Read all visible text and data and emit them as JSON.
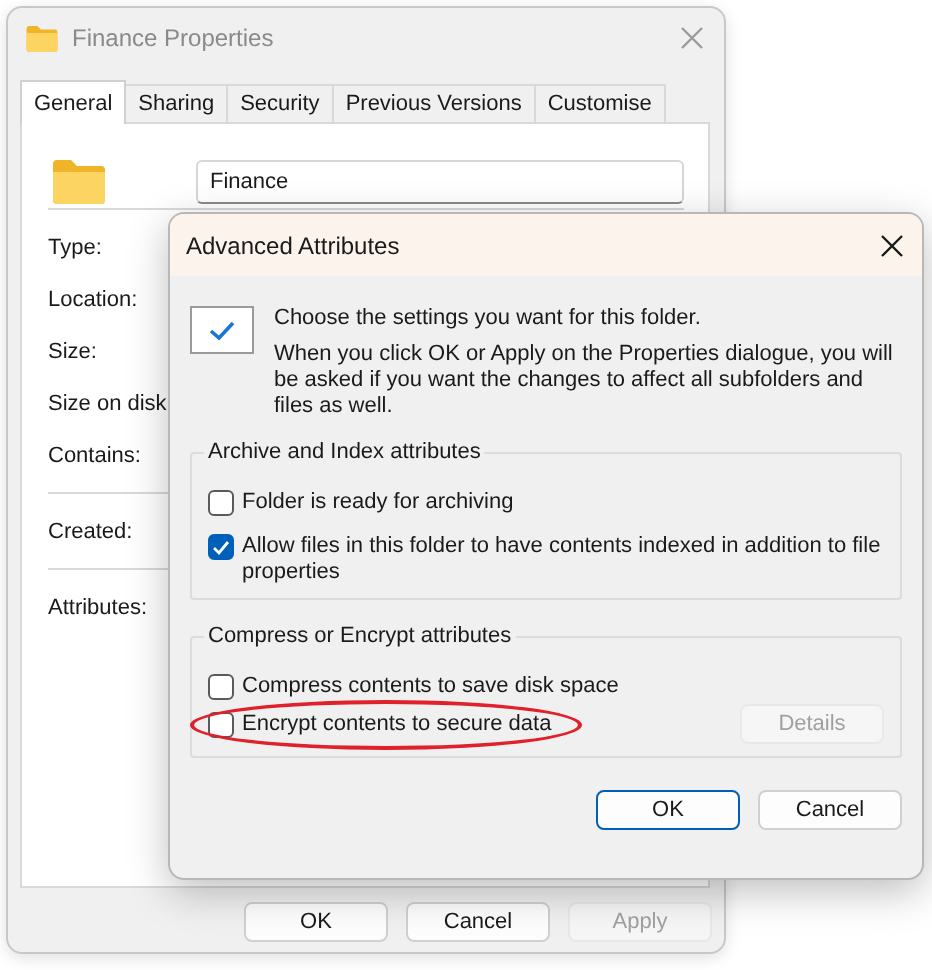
{
  "properties_window": {
    "title": "Finance Properties",
    "active": false,
    "tabs": [
      {
        "label": "General",
        "selected": true
      },
      {
        "label": "Sharing",
        "selected": false
      },
      {
        "label": "Security",
        "selected": false
      },
      {
        "label": "Previous Versions",
        "selected": false
      },
      {
        "label": "Customise",
        "selected": false
      }
    ],
    "name_field": {
      "value": "Finance"
    },
    "sections": [
      [
        "Type:",
        "Location:",
        "Size:",
        "Size on disk:",
        "Contains:"
      ],
      [
        "Created:"
      ],
      [
        "Attributes:"
      ]
    ],
    "buttons": [
      {
        "label": "OK",
        "disabled": false
      },
      {
        "label": "Cancel",
        "disabled": false
      },
      {
        "label": "Apply",
        "disabled": true
      }
    ]
  },
  "advanced_dialog": {
    "title": "Advanced Attributes",
    "heading": "Choose the settings you want for this folder.",
    "description": "When you click OK or Apply on the Properties dialogue, you will be asked if you want the changes to affect all subfolders and files as well.",
    "groups": [
      {
        "title": "Archive and Index attributes",
        "options": [
          {
            "label": "Folder is ready for archiving",
            "checked": false,
            "highlighted": false
          },
          {
            "label": "Allow files in this folder to have contents indexed in addition to file properties",
            "checked": true,
            "highlighted": false
          }
        ]
      },
      {
        "title": "Compress or Encrypt attributes",
        "options": [
          {
            "label": "Compress contents to save disk space",
            "checked": false,
            "highlighted": false
          },
          {
            "label": "Encrypt contents to secure data",
            "checked": false,
            "highlighted": true
          }
        ],
        "details_button": {
          "label": "Details",
          "disabled": true
        }
      }
    ],
    "buttons": [
      {
        "label": "OK",
        "default": true
      },
      {
        "label": "Cancel",
        "default": false
      }
    ]
  }
}
